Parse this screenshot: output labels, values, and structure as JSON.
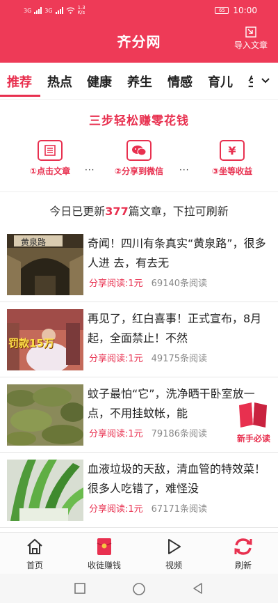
{
  "status_bar": {
    "signal_left": "3G",
    "signal_right": "3G",
    "speed": "1.3",
    "speed_unit": "K/s",
    "battery": "65",
    "time": "10:00"
  },
  "header": {
    "title": "齐分网",
    "import_label": "导入文章"
  },
  "tabs": [
    "推荐",
    "热点",
    "健康",
    "养生",
    "情感",
    "育儿",
    "生"
  ],
  "promo": {
    "title": "三步轻松赚零花钱",
    "steps": [
      "①点击文章",
      "②分享到微信",
      "③坐等收益"
    ],
    "dots": "···"
  },
  "update": {
    "prefix": "今日已更新",
    "count": "377",
    "suffix": "篇文章，下拉可刷新"
  },
  "articles": [
    {
      "title": "奇闻！四川有条真实“黄泉路”，很多人进 去，有去无",
      "share": "分享阅读:1元",
      "reads": "69140条阅读",
      "thumb_text": "黄泉路"
    },
    {
      "title": "再见了，红白喜事！正式宣布，8月起，全面禁止！不然",
      "share": "分享阅读:1元",
      "reads": "49175条阅读",
      "thumb_text": "罚款15万"
    },
    {
      "title": "蚊子最怕“它”，洗净晒干卧室放一点，不用挂蚊帐，能",
      "share": "分享阅读:1元",
      "reads": "79186条阅读",
      "thumb_text": ""
    },
    {
      "title": "血液垃圾的天敌，清血管的特效菜！很多人吃错了，难怪没",
      "share": "分享阅读:1元",
      "reads": "67171条阅读",
      "thumb_text": ""
    }
  ],
  "float_badge": "新手必读",
  "bottom_nav": [
    {
      "label": "首页",
      "icon": "home-icon"
    },
    {
      "label": "收徒赚钱",
      "icon": "red-envelope-icon"
    },
    {
      "label": "视频",
      "icon": "play-icon"
    },
    {
      "label": "刷新",
      "icon": "refresh-icon"
    }
  ],
  "colors": {
    "accent": "#ee3a57",
    "text": "#222222",
    "muted": "#888888"
  }
}
